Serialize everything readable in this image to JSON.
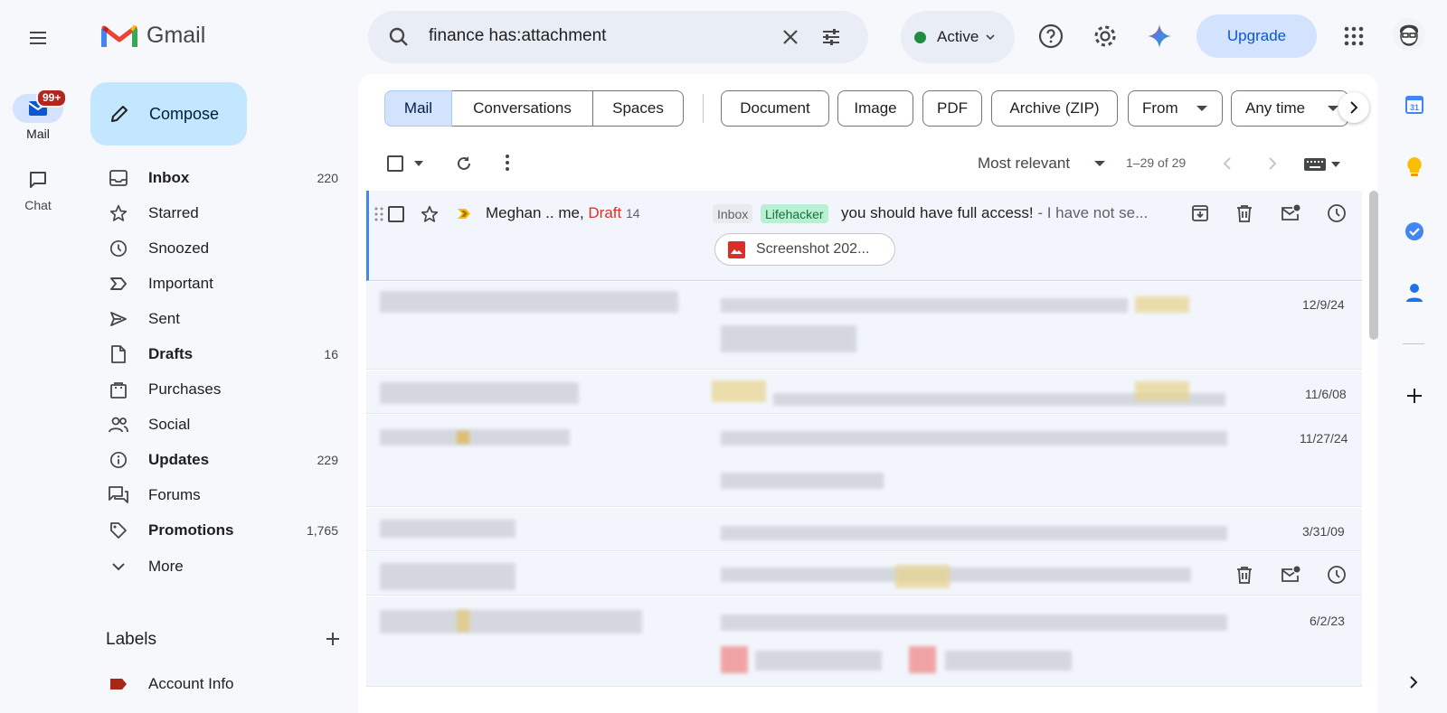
{
  "app": {
    "name": "Gmail"
  },
  "rail": {
    "mail_label": "Mail",
    "mail_badge": "99+",
    "chat_label": "Chat"
  },
  "sidebar": {
    "compose_label": "Compose",
    "items": [
      {
        "label": "Inbox",
        "count": "220",
        "bold": true,
        "icon": "inbox-icon"
      },
      {
        "label": "Starred",
        "count": "",
        "bold": false,
        "icon": "star-icon"
      },
      {
        "label": "Snoozed",
        "count": "",
        "bold": false,
        "icon": "clock-icon"
      },
      {
        "label": "Important",
        "count": "",
        "bold": false,
        "icon": "important-icon"
      },
      {
        "label": "Sent",
        "count": "",
        "bold": false,
        "icon": "send-icon"
      },
      {
        "label": "Drafts",
        "count": "16",
        "bold": true,
        "icon": "file-icon"
      },
      {
        "label": "Purchases",
        "count": "",
        "bold": false,
        "icon": "bag-icon"
      },
      {
        "label": "Social",
        "count": "",
        "bold": false,
        "icon": "people-icon"
      },
      {
        "label": "Updates",
        "count": "229",
        "bold": true,
        "icon": "info-icon"
      },
      {
        "label": "Forums",
        "count": "",
        "bold": false,
        "icon": "forum-icon"
      },
      {
        "label": "Promotions",
        "count": "1,765",
        "bold": true,
        "icon": "tag-icon"
      },
      {
        "label": "More",
        "count": "",
        "bold": false,
        "icon": "chevron-down-icon"
      }
    ],
    "labels_heading": "Labels",
    "labels": [
      {
        "label": "Account Info",
        "color": "#a52714"
      }
    ]
  },
  "search": {
    "query": "finance has:attachment"
  },
  "status": {
    "label": "Active",
    "color": "#1e8e3e"
  },
  "header": {
    "upgrade_label": "Upgrade"
  },
  "filters": {
    "segments": [
      "Mail",
      "Conversations",
      "Spaces"
    ],
    "chips": [
      "Document",
      "Image",
      "PDF",
      "Archive (ZIP)",
      "From",
      "Any time"
    ]
  },
  "toolbar": {
    "sort_label": "Most relevant",
    "pagination": "1–29 of 29"
  },
  "emails": [
    {
      "sender": "Meghan .. me,",
      "draft": "Draft",
      "count": "14",
      "labels": [
        {
          "text": "Inbox",
          "bg": "#e8eaed",
          "fg": "#5f6368"
        },
        {
          "text": "Lifehacker",
          "bg": "#a8e6cf",
          "fg": "#137333"
        }
      ],
      "subject": "you should have full access!",
      "snippet": " - I have not se...",
      "attachment": "Screenshot 202..."
    }
  ],
  "dates": [
    "12/9/24",
    "11/6/08",
    "11/27/24",
    "3/31/09",
    "6/2/23"
  ],
  "colors": {
    "accent": "#0b57d0",
    "selected_bg": "#d3e3fd",
    "compose_bg": "#c2e7ff"
  }
}
